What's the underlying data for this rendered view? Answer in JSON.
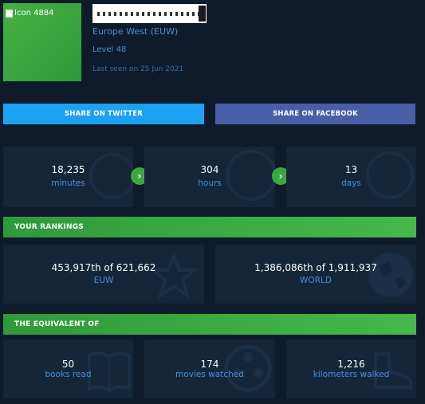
{
  "profile": {
    "avatar_alt": "Icon 4884",
    "region": "Europe West (EUW)",
    "level": "Level 48",
    "last_seen": "Last seen on 25 Jun 2021"
  },
  "share": {
    "twitter": "SHARE ON TWITTER",
    "facebook": "SHARE ON FACEBOOK"
  },
  "time": [
    {
      "value": "18,235",
      "unit": "minutes"
    },
    {
      "value": "304",
      "unit": "hours"
    },
    {
      "value": "13",
      "unit": "days"
    }
  ],
  "rankings": {
    "title": "YOUR RANKINGS",
    "items": [
      {
        "value": "453,917th of 621,662",
        "scope": "EUW"
      },
      {
        "value": "1,386,086th of 1,911,937",
        "scope": "WORLD"
      }
    ]
  },
  "equivalent": {
    "title": "THE EQUIVALENT OF",
    "items": [
      {
        "value": "50",
        "label": "books read"
      },
      {
        "value": "174",
        "label": "movies watched"
      },
      {
        "value": "1,216",
        "label": "kilometers walked"
      }
    ]
  },
  "icons": {
    "arrow": "chevron-right-icon",
    "clock": "clock-icon",
    "star": "star-icon",
    "globe": "globe-icon",
    "book": "book-icon",
    "film": "film-reel-icon",
    "shoe": "shoe-icon"
  },
  "colors": {
    "background": "#0e1b2b",
    "panel": "#142638",
    "accent_green": "#3aa93d",
    "text_blue": "#4a8fd8",
    "twitter": "#1da1f2",
    "facebook": "#4a5ea8"
  }
}
